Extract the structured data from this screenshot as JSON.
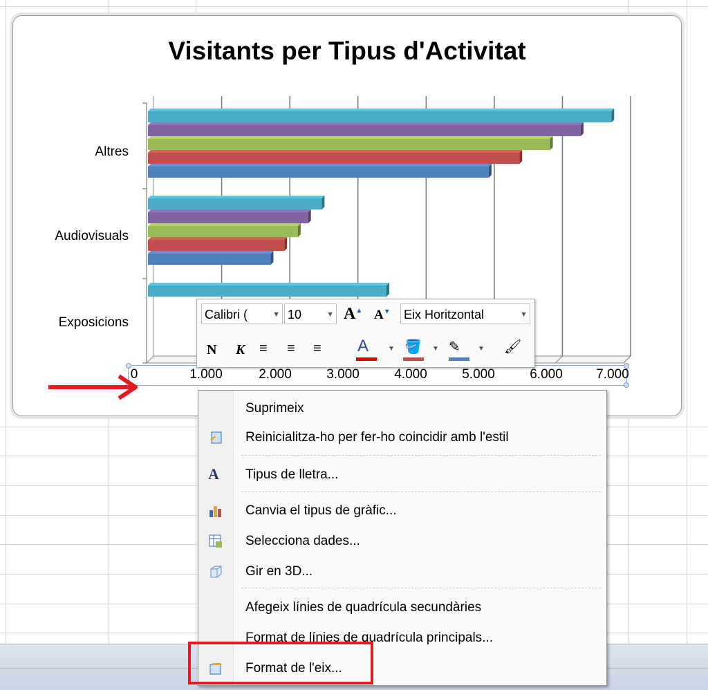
{
  "chart_data": {
    "type": "bar",
    "orientation": "horizontal",
    "title": "Visitants per Tipus d'Activitat",
    "categories": [
      "Altres",
      "Audiovisuals",
      "Exposicions"
    ],
    "series": [
      {
        "values": [
          5000,
          1800,
          0
        ],
        "color": "#4f81bd"
      },
      {
        "values": [
          5450,
          2000,
          0
        ],
        "color": "#c0504d"
      },
      {
        "values": [
          5900,
          2200,
          0
        ],
        "color": "#9bbb59"
      },
      {
        "values": [
          6350,
          2350,
          0
        ],
        "color": "#8064a2"
      },
      {
        "values": [
          6800,
          2550,
          3500
        ],
        "color": "#4bacc6"
      }
    ],
    "x_ticks": [
      "0",
      "1.000",
      "2.000",
      "3.000",
      "4.000",
      "5.000",
      "6.000",
      "7.000"
    ],
    "xlim": [
      0,
      7000
    ],
    "grid": true
  },
  "mini_toolbar": {
    "font_name": "Calibri (",
    "font_size": "10",
    "grow_font": "A",
    "shrink_font": "A",
    "element_select": "Eix Horitzontal",
    "bold": "N",
    "italic": "K",
    "font_color": "A"
  },
  "context_menu": {
    "items": [
      {
        "label": "Suprimeix",
        "icon": "none"
      },
      {
        "label": "Reinicialitza-ho per fer-ho coincidir amb l'estil",
        "icon": "reset-style-icon"
      },
      {
        "label": "Tipus de lletra...",
        "icon": "font-icon"
      },
      {
        "label": "Canvia el tipus de gràfic...",
        "icon": "chart-type-icon"
      },
      {
        "label": "Selecciona dades...",
        "icon": "select-data-icon"
      },
      {
        "label": "Gir en 3D...",
        "icon": "rotation-3d-icon"
      },
      {
        "label": "Afegeix línies de quadrícula secundàries",
        "icon": "none"
      },
      {
        "label": "Format de línies de quadrícula principals...",
        "icon": "none"
      },
      {
        "label": "Format de l'eix...",
        "icon": "format-axis-icon"
      }
    ]
  },
  "colors": {
    "annotation_red": "#e21b23",
    "menu_background": "#fafafa"
  }
}
